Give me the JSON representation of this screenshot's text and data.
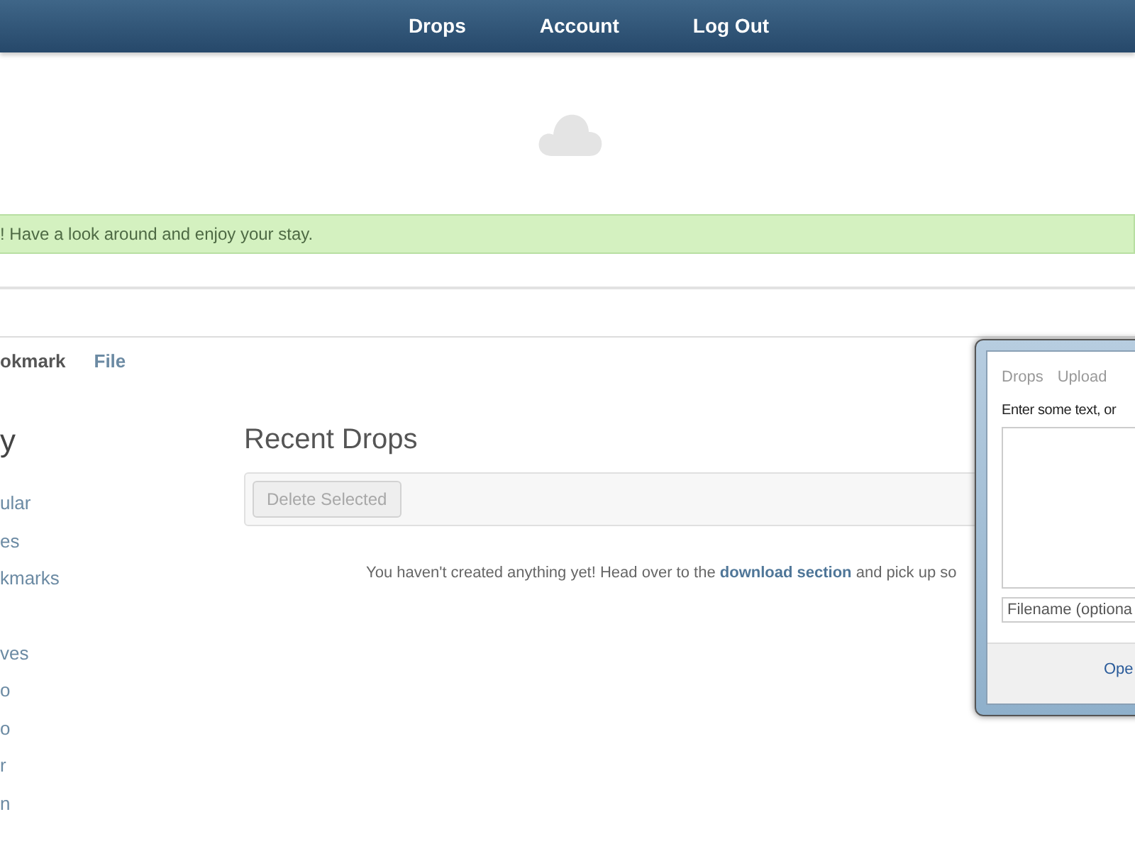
{
  "nav": {
    "links": [
      "Drops",
      "Account",
      "Log Out"
    ]
  },
  "alert": {
    "text": "! Have a look around and enjoy your stay."
  },
  "tabs": [
    {
      "label": "okmark",
      "selected": true
    },
    {
      "label": "File",
      "selected": false
    }
  ],
  "sidebar": {
    "heading": "y",
    "groups": [
      [
        "ular",
        "es",
        "kmarks"
      ],
      [
        "ves",
        "o",
        "o",
        "r",
        "n"
      ]
    ]
  },
  "main": {
    "title": "Recent Drops",
    "delete_button": {
      "label": "Delete Selected",
      "disabled": true
    },
    "message": {
      "before": "You haven't created anything yet! Head over to the ",
      "link": "download section",
      "after": " and pick up so"
    }
  },
  "dialog": {
    "tabs": [
      "Drops",
      "Upload"
    ],
    "prompt": "Enter some text, or",
    "filename_placeholder": "Filename (optiona",
    "action": "Ope"
  }
}
